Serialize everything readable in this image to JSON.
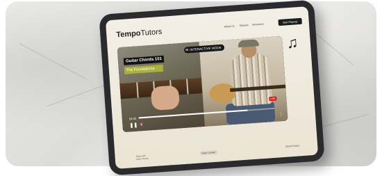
{
  "brand": {
    "name_bold": "Tempo",
    "name_light": "Tutors"
  },
  "nav": {
    "links": [
      "About Us",
      "Classes",
      "Instructors"
    ],
    "cta": "Start Playing!"
  },
  "video": {
    "title": "Guitar Chords 101",
    "subtitle": "The Foundations",
    "mode_badge": "INTERACTIVE MODE",
    "live_badge": "LIVE",
    "time": "54:32",
    "progress": 0.8
  },
  "footer": {
    "left_line1": "Share with",
    "left_line2": "Invite Friends",
    "center": "Save Lesson",
    "right": "Chord Charts"
  },
  "icons": {
    "music": "music-note-icon",
    "pause": "pause-icon",
    "mute": "mute-icon",
    "more": "more-icon"
  }
}
